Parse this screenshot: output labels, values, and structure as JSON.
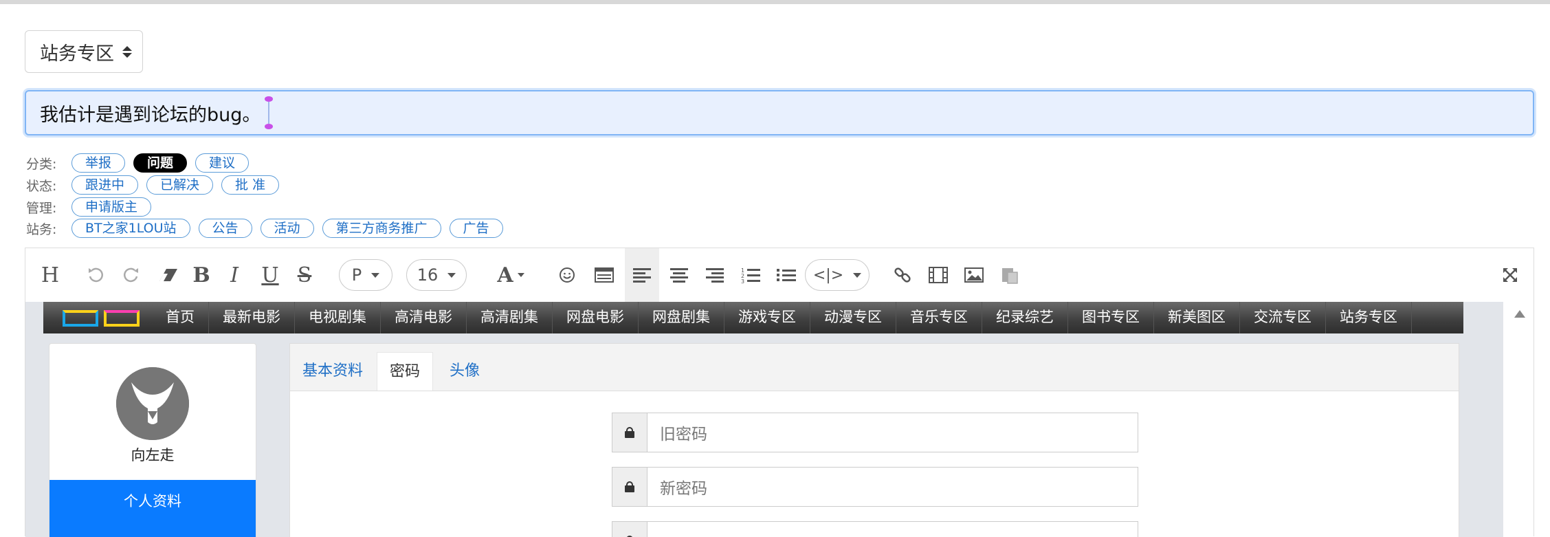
{
  "forum_select": {
    "value": "站务专区"
  },
  "subject": {
    "value": "我估计是遇到论坛的bug。"
  },
  "tag_groups": [
    {
      "label": "分类:",
      "tags": [
        {
          "text": "举报",
          "active": false
        },
        {
          "text": "问题",
          "active": true
        },
        {
          "text": "建议",
          "active": false
        }
      ]
    },
    {
      "label": "状态:",
      "tags": [
        {
          "text": "跟进中",
          "active": false
        },
        {
          "text": "已解决",
          "active": false
        },
        {
          "text": "批 准",
          "active": false
        }
      ]
    },
    {
      "label": "管理:",
      "tags": [
        {
          "text": "申请版主",
          "active": false
        }
      ]
    },
    {
      "label": "站务:",
      "tags": [
        {
          "text": "BT之家1LOU站",
          "active": false
        },
        {
          "text": "公告",
          "active": false
        },
        {
          "text": "活动",
          "active": false
        },
        {
          "text": "第三方商务推广",
          "active": false
        },
        {
          "text": "广告",
          "active": false
        }
      ]
    }
  ],
  "toolbar": {
    "paragraph_value": "P",
    "font_size_value": "16",
    "code_label": "<|>"
  },
  "preview": {
    "nav_items": [
      "首页",
      "最新电影",
      "电视剧集",
      "高清电影",
      "高清剧集",
      "网盘电影",
      "网盘剧集",
      "游戏专区",
      "动漫专区",
      "音乐专区",
      "纪录综艺",
      "图书专区",
      "新美图区",
      "交流专区",
      "站务专区"
    ],
    "username": "向左走",
    "profile_button": "个人资料",
    "tabs": [
      "基本资料",
      "密码",
      "头像"
    ],
    "selected_tab": "密码",
    "old_password_placeholder": "旧密码",
    "new_password_placeholder": "新密码"
  }
}
